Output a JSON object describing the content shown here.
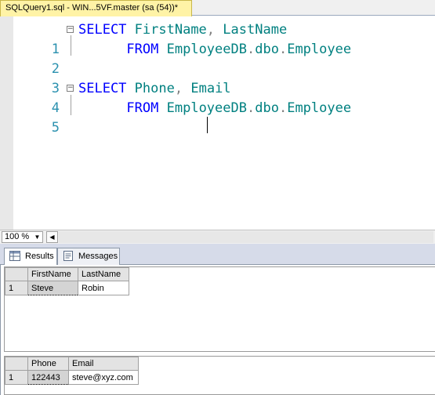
{
  "doc_tab": {
    "title": "SQLQuery1.sql - WIN...5VF.master (sa (54))*",
    "close": "×"
  },
  "editor": {
    "lines": [
      {
        "num": "1",
        "kw1": "SELECT",
        "a": "FirstName",
        "sep": ",",
        "b": "LastName",
        "fold": "−"
      },
      {
        "num": "2",
        "kw1": "FROM",
        "a": "EmployeeDB",
        "sep": ".",
        "b": "dbo",
        "sep2": ".",
        "c": "Employee"
      },
      {
        "num": "3"
      },
      {
        "num": "4",
        "kw1": "SELECT",
        "a": "Phone",
        "sep": ",",
        "b": "Email",
        "fold": "−"
      },
      {
        "num": "5",
        "kw1": "FROM",
        "a": "EmployeeDB",
        "sep": ".",
        "b": "dbo",
        "sep2": ".",
        "c": "Employee"
      }
    ]
  },
  "zoom": {
    "value": "100 %",
    "arrow": "▼",
    "scroll_left": "◀"
  },
  "results_tabs": [
    {
      "label": "Results",
      "active": true
    },
    {
      "label": "Messages",
      "active": false
    }
  ],
  "grid1": {
    "columns": [
      "FirstName",
      "LastName"
    ],
    "rows": [
      {
        "num": "1",
        "cells": [
          "Steve",
          "Robin"
        ]
      }
    ]
  },
  "grid2": {
    "columns": [
      "Phone",
      "Email"
    ],
    "rows": [
      {
        "num": "1",
        "cells": [
          "122443",
          "steve@xyz.com"
        ]
      }
    ]
  },
  "colors": {
    "keyword": "#0000ff",
    "identifier": "#008080",
    "line_number": "#2b91af",
    "tab_highlight": "#fff3a6"
  }
}
